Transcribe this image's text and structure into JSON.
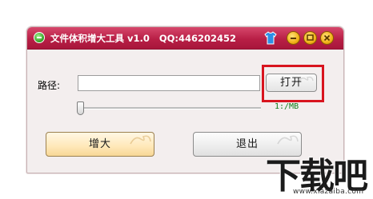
{
  "window": {
    "title": "文件体积增大工具 v1.0",
    "qq": "QQ:446202452"
  },
  "form": {
    "path_label": "路径:",
    "path_value": "",
    "open_button": "打开",
    "size_readout": "1:/MB",
    "slider_value": 0
  },
  "actions": {
    "enlarge_button": "增大",
    "exit_button": "退出"
  },
  "watermark": {
    "brand": "下载吧",
    "url": "www.xiazaiba.com"
  },
  "colors": {
    "titlebar": "#c02a50",
    "highlight_box": "#d8141e",
    "size_readout": "#0f7d18",
    "enlarge_button": "#ffe8b8"
  },
  "icons": {
    "app": "app-icon",
    "skin": "shirt-icon",
    "minimize": "minimize-icon",
    "maximize": "maximize-icon",
    "close": "close-icon"
  }
}
